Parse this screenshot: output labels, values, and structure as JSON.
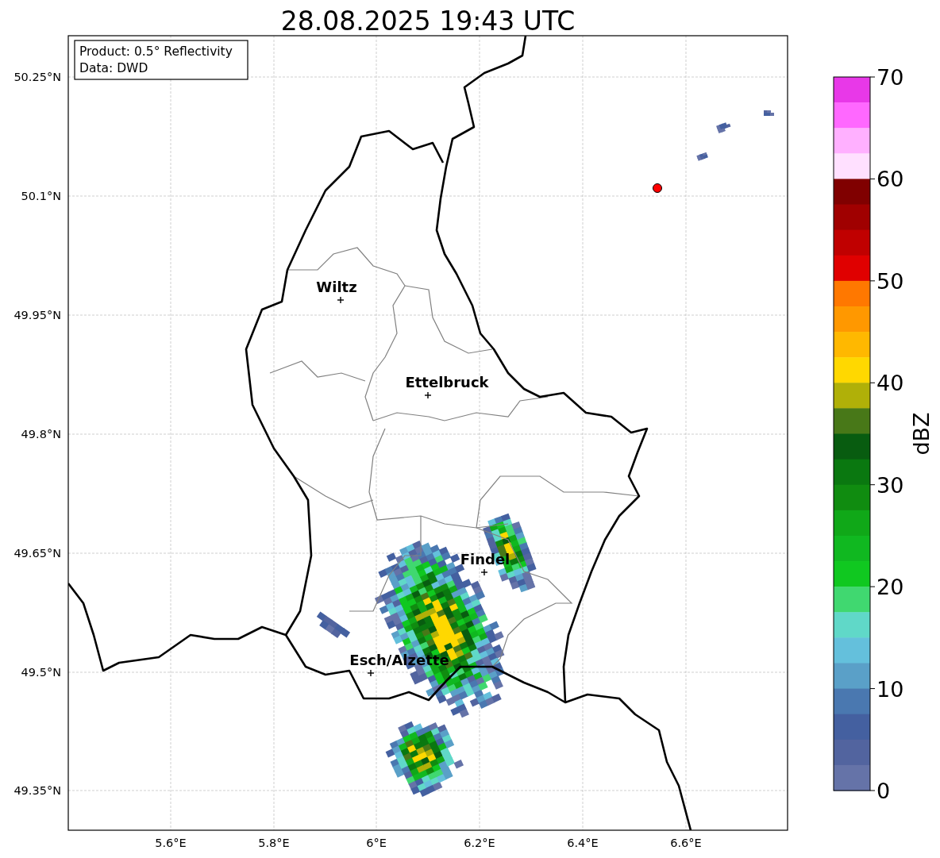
{
  "title": "28.08.2025 19:43 UTC",
  "info_box": [
    "Product: 0.5° Reflectivity",
    "Data: DWD"
  ],
  "map": {
    "lon_labels": [
      "5.6°E",
      "5.8°E",
      "6°E",
      "6.2°E",
      "6.4°E",
      "6.6°E"
    ],
    "lat_labels": [
      "50.25°N",
      "50.1°N",
      "49.95°N",
      "49.8°N",
      "49.65°N",
      "49.5°N",
      "49.35°N"
    ],
    "cities": [
      {
        "name": "Wiltz"
      },
      {
        "name": "Ettelbruck"
      },
      {
        "name": "Findel"
      },
      {
        "name": "Esch/Alzette"
      }
    ]
  },
  "colorbar": {
    "label": "dBZ",
    "ticks": [
      "70",
      "60",
      "50",
      "40",
      "30",
      "20",
      "10",
      "0"
    ],
    "bins": [
      {
        "color": "#e838e8"
      },
      {
        "color": "#ff68ff"
      },
      {
        "color": "#ffb0ff"
      },
      {
        "color": "#ffe0ff"
      },
      {
        "color": "#800000"
      },
      {
        "color": "#a00000"
      },
      {
        "color": "#c00000"
      },
      {
        "color": "#e00000"
      },
      {
        "color": "#ff7800"
      },
      {
        "color": "#ff9800"
      },
      {
        "color": "#ffb800"
      },
      {
        "color": "#ffd800"
      },
      {
        "color": "#b0b008"
      },
      {
        "color": "#487818"
      },
      {
        "color": "#085c10"
      },
      {
        "color": "#0a7810"
      },
      {
        "color": "#108c10"
      },
      {
        "color": "#10a818"
      },
      {
        "color": "#10b820"
      },
      {
        "color": "#10c820"
      },
      {
        "color": "#40d870"
      },
      {
        "color": "#60d8c8"
      },
      {
        "color": "#64c0dc"
      },
      {
        "color": "#5aa0c8"
      },
      {
        "color": "#4a78b0"
      },
      {
        "color": "#4460a0"
      },
      {
        "color": "#52649f"
      },
      {
        "color": "#6573a8"
      }
    ]
  }
}
